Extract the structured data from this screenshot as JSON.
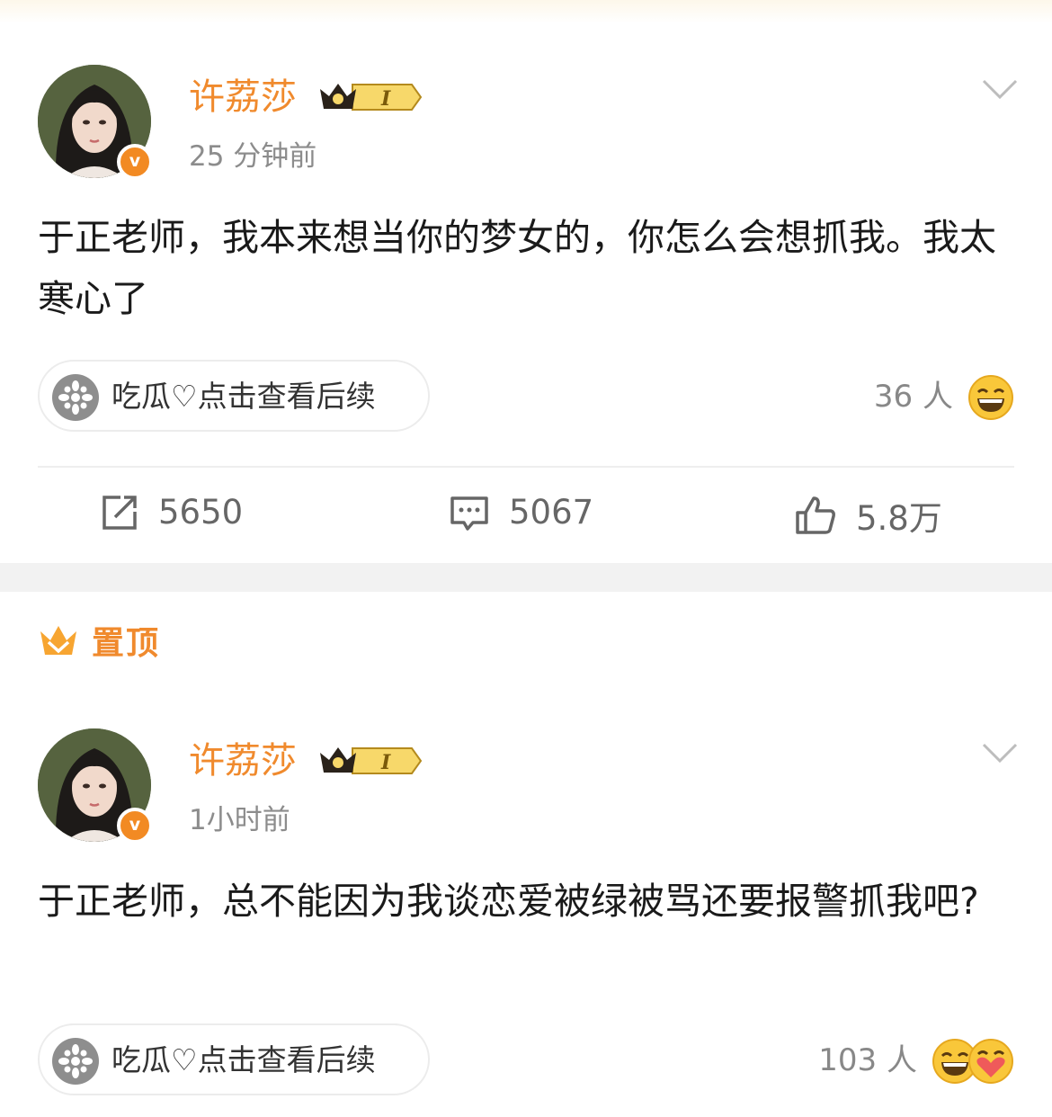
{
  "posts": [
    {
      "username": "许荔莎",
      "vip_level": "I",
      "verified_badge": "v",
      "time": "25 分钟前",
      "content": "于正老师，我本来想当你的梦女的，你怎么会想抓我。我太寒心了",
      "topic_pill": "吃瓜♡点击查看后续",
      "reaction_count": "36 人",
      "actions": {
        "repost": "5650",
        "comment": "5067",
        "like": "5.8万"
      }
    },
    {
      "pinned_label": "置顶",
      "username": "许荔莎",
      "vip_level": "I",
      "verified_badge": "v",
      "time": "1小时前",
      "content": "于正老师，总不能因为我谈恋爱被绿被骂还要报警抓我吧?",
      "topic_pill": "吃瓜♡点击查看后续",
      "reaction_count": "103 人"
    }
  ],
  "colors": {
    "accent": "#f08a2d",
    "muted": "#8c8c8c",
    "verified": "#f28a23"
  },
  "icons": [
    "chevron-down-icon",
    "repost-icon",
    "comment-icon",
    "like-icon",
    "melon-icon",
    "laugh-emoji-icon",
    "love-emoji-icon",
    "crown-icon"
  ]
}
